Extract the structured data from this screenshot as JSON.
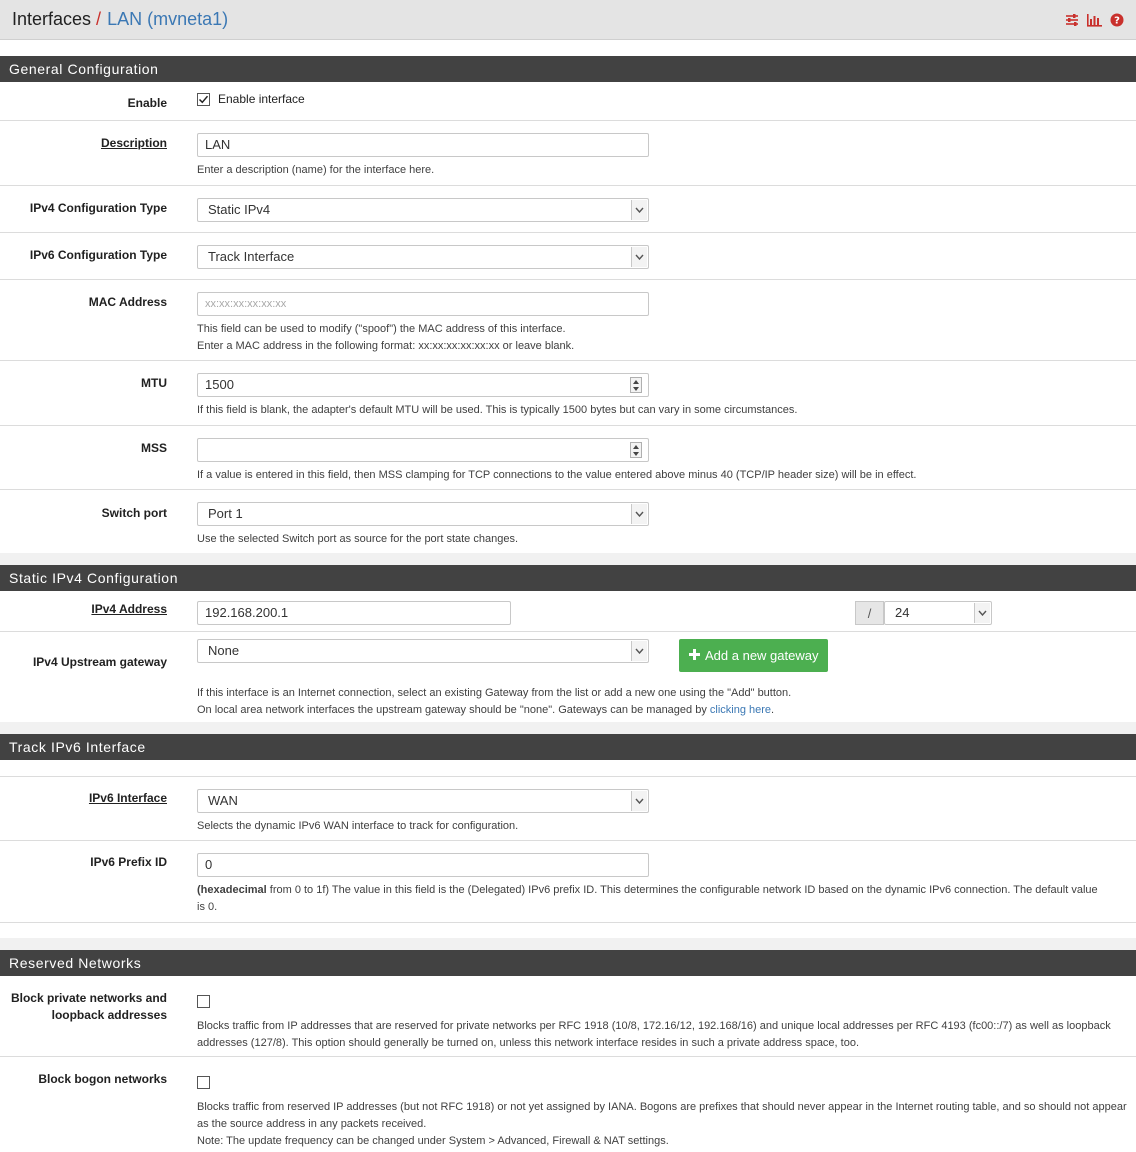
{
  "header": {
    "crumb_root": "Interfaces",
    "crumb_sep": "/",
    "crumb_current": "LAN (mvneta1)",
    "icons": [
      "sliders-icon",
      "bar-chart-icon",
      "help-icon"
    ]
  },
  "colors": {
    "panel_header_bg": "#424242",
    "accent_red": "#c9302c",
    "link_blue": "#3b78b4",
    "success_green": "#4caf50"
  },
  "general": {
    "title": "General Configuration",
    "enable": {
      "label": "Enable",
      "checkbox_label": "Enable interface",
      "checked": true
    },
    "description": {
      "label": "Description",
      "value": "LAN",
      "help": "Enter a description (name) for the interface here."
    },
    "ipv4_type": {
      "label": "IPv4 Configuration Type",
      "value": "Static IPv4"
    },
    "ipv6_type": {
      "label": "IPv6 Configuration Type",
      "value": "Track Interface"
    },
    "mac": {
      "label": "MAC Address",
      "placeholder": "xx:xx:xx:xx:xx:xx",
      "help1": "This field can be used to modify (\"spoof\") the MAC address of this interface.",
      "help2": "Enter a MAC address in the following format: xx:xx:xx:xx:xx:xx or leave blank."
    },
    "mtu": {
      "label": "MTU",
      "value": "1500",
      "help": "If this field is blank, the adapter's default MTU will be used. This is typically 1500 bytes but can vary in some circumstances."
    },
    "mss": {
      "label": "MSS",
      "value": "",
      "help": "If a value is entered in this field, then MSS clamping for TCP connections to the value entered above minus 40 (TCP/IP header size) will be in effect."
    },
    "switch_port": {
      "label": "Switch port",
      "value": "Port 1",
      "help": "Use the selected Switch port as source for the port state changes."
    }
  },
  "static_ipv4": {
    "title": "Static IPv4 Configuration",
    "address": {
      "label": "IPv4 Address",
      "value": "192.168.200.1",
      "slash": "/",
      "cidr": "24"
    },
    "gateway": {
      "label": "IPv4 Upstream gateway",
      "value": "None",
      "button": "Add a new gateway",
      "help1": "If this interface is an Internet connection, select an existing Gateway from the list or add a new one using the \"Add\" button.",
      "help2_pre": "On local area network interfaces the upstream gateway should be \"none\". Gateways can be managed by ",
      "help2_link": "clicking here",
      "help2_post": "."
    }
  },
  "track_ipv6": {
    "title": "Track IPv6 Interface",
    "interface": {
      "label": "IPv6 Interface",
      "value": "WAN",
      "help": "Selects the dynamic IPv6 WAN interface to track for configuration."
    },
    "prefix_id": {
      "label": "IPv6 Prefix ID",
      "value": "0",
      "help_bold": "(hexadecimal",
      "help_rest": " from 0 to 1f) The value in this field is the (Delegated) IPv6 prefix ID. This determines the configurable network ID based on the dynamic IPv6 connection. The default value is 0."
    }
  },
  "reserved": {
    "title": "Reserved Networks",
    "private": {
      "label": "Block private networks and loopback addresses",
      "checked": false,
      "help": "Blocks traffic from IP addresses that are reserved for private networks per RFC 1918 (10/8, 172.16/12, 192.168/16) and unique local addresses per RFC 4193 (fc00::/7) as well as loopback addresses (127/8). This option should generally be turned on, unless this network interface resides in such a private address space, too."
    },
    "bogon": {
      "label": "Block bogon networks",
      "checked": false,
      "help1": "Blocks traffic from reserved IP addresses (but not RFC 1918) or not yet assigned by IANA. Bogons are prefixes that should never appear in the Internet routing table, and so should not appear as the source address in any packets received.",
      "help2": "Note: The update frequency can be changed under System > Advanced, Firewall & NAT settings."
    }
  }
}
